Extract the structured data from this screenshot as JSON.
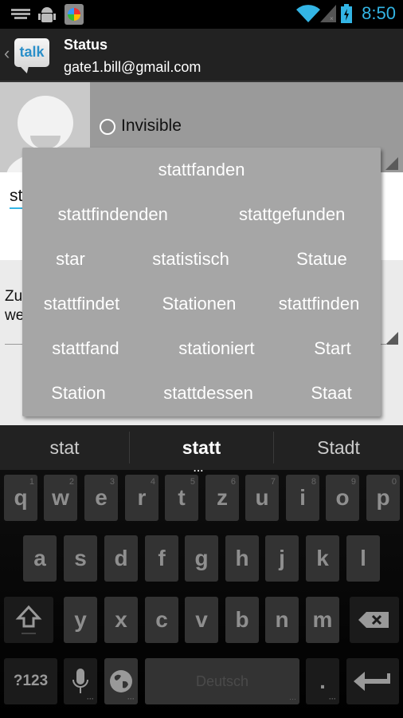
{
  "status_bar": {
    "left_icons": [
      "keyboard-icon",
      "android-debug-icon",
      "app-update-icon"
    ],
    "right_icons": [
      "wifi-icon",
      "no-signal-icon",
      "battery-charging-icon"
    ],
    "time": "8:50",
    "accent_color": "#33b5e5"
  },
  "action_bar": {
    "back_glyph": "‹",
    "logo_text": "talk",
    "title": "Status",
    "subtitle": "gate1.bill@gmail.com"
  },
  "status_section": {
    "selected_status": "Invisible"
  },
  "status_input": {
    "value": "st"
  },
  "status_message": {
    "text_line1": "Zu",
    "text_line2": "we"
  },
  "popup": {
    "rows": [
      [
        "stattfanden"
      ],
      [
        "stattfindenden",
        "stattgefunden"
      ],
      [
        "star",
        "statistisch",
        "Statue"
      ],
      [
        "stattfindet",
        "Stationen",
        "stattfinden"
      ],
      [
        "stattfand",
        "stationiert",
        "Start"
      ],
      [
        "Station",
        "stattdessen",
        "Staat"
      ]
    ]
  },
  "keyboard": {
    "suggestions": [
      "stat",
      "statt",
      "Stadt"
    ],
    "more_indicator": "...",
    "row1": [
      {
        "label": "q",
        "hint": "1"
      },
      {
        "label": "w",
        "hint": "2"
      },
      {
        "label": "e",
        "hint": "3"
      },
      {
        "label": "r",
        "hint": "4"
      },
      {
        "label": "t",
        "hint": "5"
      },
      {
        "label": "z",
        "hint": "6"
      },
      {
        "label": "u",
        "hint": "7"
      },
      {
        "label": "i",
        "hint": "8"
      },
      {
        "label": "o",
        "hint": "9"
      },
      {
        "label": "p",
        "hint": "0"
      }
    ],
    "row2": [
      "a",
      "s",
      "d",
      "f",
      "g",
      "h",
      "j",
      "k",
      "l"
    ],
    "row3": [
      "y",
      "x",
      "c",
      "v",
      "b",
      "n",
      "m"
    ],
    "symbols_label": "?123",
    "space_label": "Deutsch",
    "period_label": "."
  }
}
